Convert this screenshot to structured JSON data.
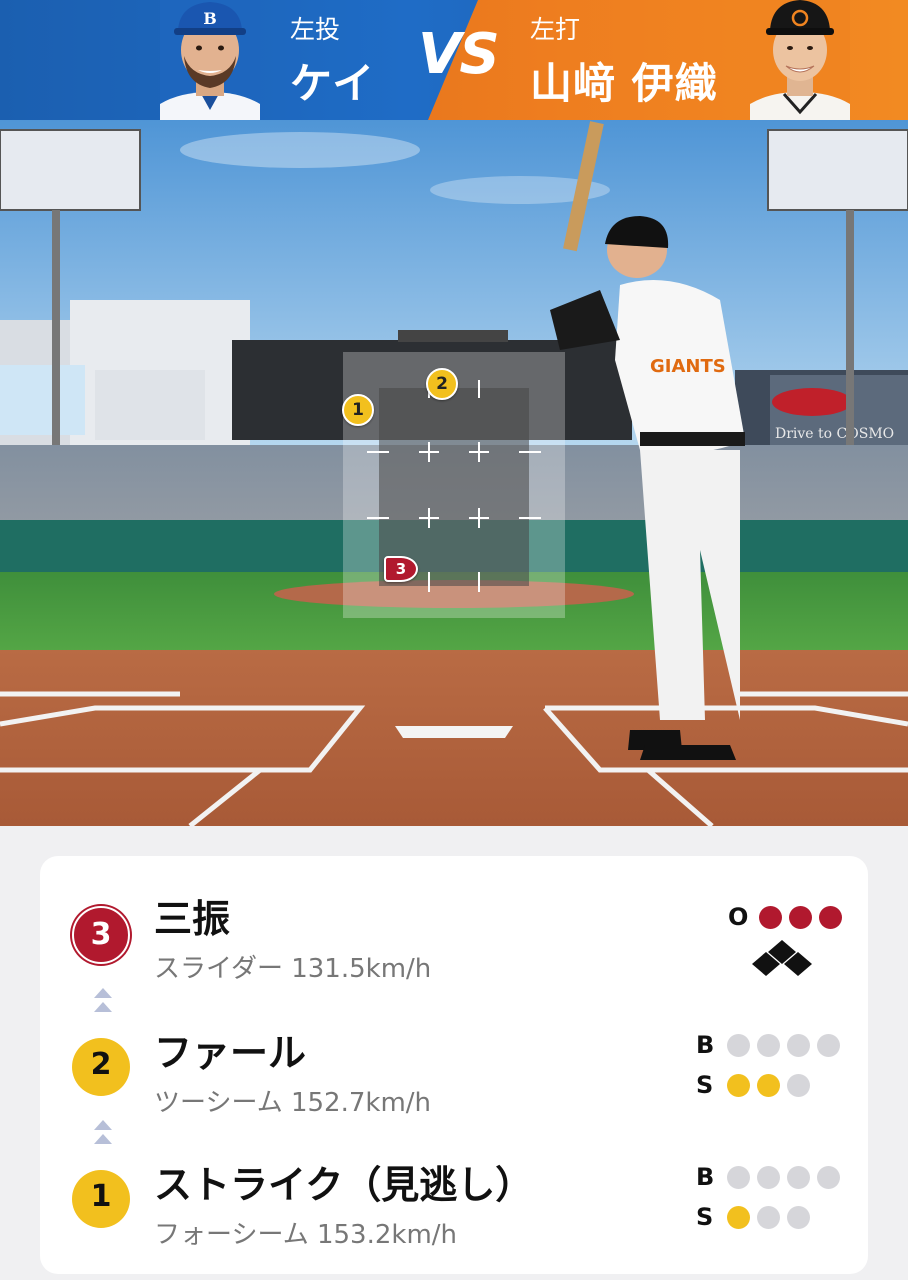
{
  "header": {
    "pitcher": {
      "hand": "左投",
      "name": "ケイ"
    },
    "vs": "VS",
    "batter": {
      "hand": "左打",
      "name": "山﨑 伊織"
    }
  },
  "field": {
    "zone_markers": [
      {
        "number": "1",
        "color": "#f2c01e"
      },
      {
        "number": "2",
        "color": "#f2c01e"
      },
      {
        "number": "3",
        "color": "#b1192e"
      }
    ],
    "billboard_text": "Drive to COSMO",
    "jersey_text": "GIANTS"
  },
  "pitches": [
    {
      "number": "3",
      "badge_color": "#b1192e",
      "result": "三振",
      "detail": "スライダー 131.5km/h",
      "count": {
        "out_label": "O",
        "outs": 3,
        "outs_max": 3
      }
    },
    {
      "number": "2",
      "badge_color": "#f2c01e",
      "result": "ファール",
      "detail": "ツーシーム 152.7km/h",
      "count": {
        "b_label": "B",
        "balls": 0,
        "balls_max": 4,
        "s_label": "S",
        "strikes": 2,
        "strikes_max": 3
      }
    },
    {
      "number": "1",
      "badge_color": "#f2c01e",
      "result": "ストライク（見逃し）",
      "detail": "フォーシーム 153.2km/h",
      "count": {
        "b_label": "B",
        "balls": 0,
        "balls_max": 4,
        "s_label": "S",
        "strikes": 1,
        "strikes_max": 3
      }
    }
  ],
  "colors": {
    "strike": "#f2c01e",
    "out": "#b1192e",
    "empty": "#d6d6da"
  }
}
